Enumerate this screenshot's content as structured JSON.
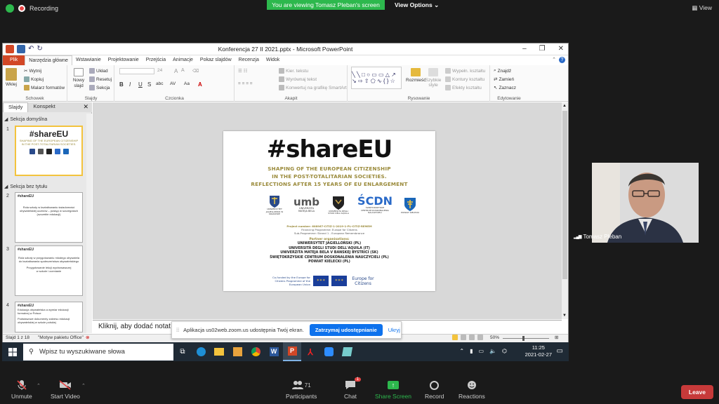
{
  "zoom_top": {
    "recording": "Recording",
    "viewing": "You are viewing Tomasz Pleban's screen",
    "view_options": "View Options",
    "view_button": "View"
  },
  "ppt": {
    "title": "Konferencja 27 II 2021.pptx - Microsoft PowerPoint",
    "tabs": [
      "Plik",
      "Narzędzia główne",
      "Wstawianie",
      "Projektowanie",
      "Przejścia",
      "Animacje",
      "Pokaz slajdów",
      "Recenzja",
      "Widok"
    ],
    "ribbon": {
      "clipboard": {
        "paste": "Wklej",
        "cut": "Wytnij",
        "copy": "Kopiuj",
        "format_painter": "Malarz formatów",
        "label": "Schowek"
      },
      "slides": {
        "new_slide": "Nowy slajd",
        "layout": "Układ",
        "reset": "Resetuj",
        "section": "Sekcja",
        "label": "Slajdy"
      },
      "font": {
        "size": "24",
        "label": "Czcionka",
        "bold": "B",
        "italic": "I",
        "underline": "U",
        "strike": "S",
        "shadow": "abc",
        "spacing": "AV",
        "case": "Aa",
        "color": "A"
      },
      "paragraph": {
        "direction": "Kier. tekstu",
        "align": "Wyrównaj tekst",
        "smartart": "Konwertuj na grafikę SmartArt",
        "label": "Akapit"
      },
      "drawing": {
        "arrange": "Rozmieść",
        "quick_styles": "Szybkie style",
        "fill": "Wypełn. kształtu",
        "outline": "Kontury kształtu",
        "effects": "Efekty kształtu",
        "label": "Rysowanie"
      },
      "editing": {
        "find": "Znajdź",
        "replace": "Zamień",
        "select": "Zaznacz",
        "label": "Edytowanie"
      }
    },
    "side_tabs": [
      "Slajdy",
      "Konspekt"
    ],
    "sections": [
      "Sekcja domyślna",
      "Sekcja bez tytułu"
    ],
    "thumbnails": [
      {
        "num": "1",
        "lines": [
          "#shareEU",
          "SHAPING OF THE EUROPEAN CITIZENSHIP",
          "IN THE POST-TOTALITARIAN SOCIETIES."
        ]
      },
      {
        "num": "2",
        "lines": [
          "#shareEU",
          "Rola szkoły w kształtowaniu świadomości",
          "obywatelskiej uczniów – postęp w szczególach",
          "(szczeble edukacji)"
        ]
      },
      {
        "num": "3",
        "lines": [
          "#shareEU",
          "Rola szkoły w przygotowaniu młodego obywatela",
          "do kształtowania społeczeństwa obywatelskiego",
          "Przygotowanie lekcji wychowawczej",
          "w szkole i ocenianie"
        ]
      },
      {
        "num": "4",
        "lines": [
          "#shareEU",
          "Edukacja obywatelska a wymiar edukacji formalnej w Polsce",
          "Podstawowe dokumenty zakresu edukacji",
          "obywatelskiej w szkole polskiej"
        ]
      }
    ],
    "notes_placeholder": "Kliknij, aby dodać notat",
    "status": {
      "slide": "Slajd 1 z 18",
      "theme": "\"Motyw pakietu Office\"",
      "zoom": "50%"
    }
  },
  "slide": {
    "hashtag": "#shareEU",
    "subtitle": [
      "SHAPING OF THE EUROPEAN CITIZENSHIP",
      "IN THE POST-TOTALITARIAN SOCIETIES.",
      "REFLECTIONS AFTER 15 YEARS OF EU ENLARGEMENT"
    ],
    "logos": [
      "UNIWERSYTET JAGIELLOŃSKI W KRAKOWIE",
      "UNIVERZITA MATEJA BELA",
      "UNIVERSITÀ DEGLI STUDI DELL'AQUILA",
      "ŚWIĘTOKRZYSKIE CENTRUM DOSKONALENIA NAUCZYCIELI",
      "POWIAT KIELECKI"
    ],
    "logo_umb": "umb",
    "logo_scdn": "ŚCDN",
    "project_lines": [
      "Project number: 608967-CITIZ-1-2019-1-PL-CITIZ-REMEM",
      "Financing Programme: Europe for Citizens",
      "Sub-Programme: Strand 1 - European Remembrance"
    ],
    "partners_title": "Partner organisations:",
    "partners": [
      "UNIWERSYTET JAGIELLOŃSKI (PL)",
      "UNIVERSITÀ DEGLI STUDI DELL'AQUILA (IT)",
      "UNIVERZITA MATEJA BELA V BANSKEJ BYSTRICI (SK)",
      "ŚWIĘTOKRZYSKIE CENTRUM DOSKONALENIA NAUCZYCIELI (PL)",
      "POWIAT KIELECKI (PL)"
    ],
    "cofunded": "Co-funded by the Europe for Citizens Programme of the European Union",
    "efc": "Europe for Citizens"
  },
  "share_banner": {
    "text": "Aplikacja us02web.zoom.us udostępnia Twój ekran.",
    "stop": "Zatrzymaj udostępnianie",
    "hide": "Ukryj"
  },
  "taskbar": {
    "search": "Wpisz tu wyszukiwane słowa",
    "time": "11:25",
    "date": "2021-02-27"
  },
  "participant": {
    "name": "Tomasz Pleban"
  },
  "zoom_bar": {
    "unmute": "Unmute",
    "start_video": "Start Video",
    "participants": "Participants",
    "participants_count": "71",
    "chat": "Chat",
    "chat_badge": "1",
    "share": "Share Screen",
    "record": "Record",
    "reactions": "Reactions",
    "leave": "Leave"
  },
  "colors": {
    "zoom_green": "#2db84d",
    "ppt_orange": "#d24726",
    "zoom_blue": "#0e72ed",
    "leave_red": "#c73a3a"
  }
}
